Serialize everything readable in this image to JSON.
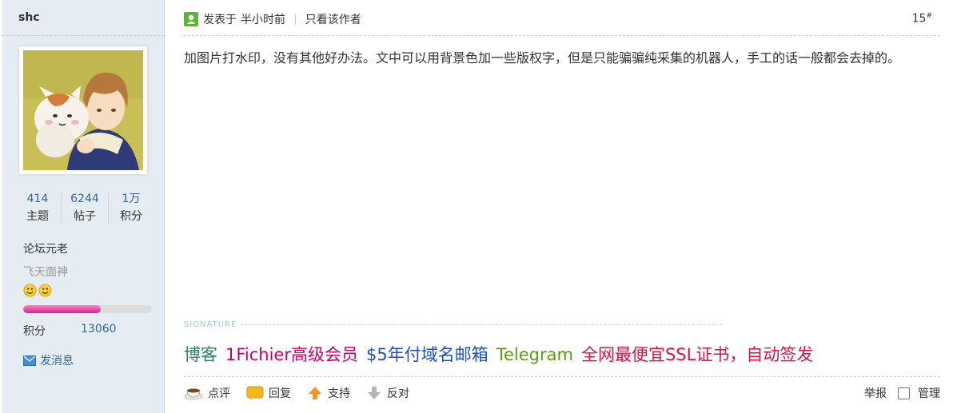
{
  "author": {
    "username": "shc",
    "stats": [
      {
        "value": "414",
        "label": "主题"
      },
      {
        "value": "6244",
        "label": "帖子"
      },
      {
        "value": "1万",
        "label": "积分"
      }
    ],
    "rank": "论坛元老",
    "custom_title": "飞天面神",
    "star_icons": [
      "smiley-face-icon",
      "smiley-face-icon"
    ],
    "progress_fraction": 0.6,
    "score_label": "积分",
    "score_value": "13060",
    "send_message_label": "发消息"
  },
  "post": {
    "posted_label": "发表于",
    "posted_time": "半小时前",
    "separator": "|",
    "only_author_label": "只看该作者",
    "floor_number": "15",
    "floor_mark": "#",
    "content": "加图片打水印，没有其他好办法。文中可以用背景色加一些版权字，但是只能骗骗纯采集的机器人，手工的话一般都会去掉的。"
  },
  "signature": {
    "label": "SIGNATURE",
    "links": [
      {
        "text": "博客",
        "color": "#2e7d6e"
      },
      {
        "text": "1Fichier高级会员",
        "color": "#cc0066"
      },
      {
        "text": "$5年付域名邮箱",
        "color": "#1e4fc2"
      },
      {
        "text": "Telegram",
        "color": "#5a9a1a"
      },
      {
        "text": "全网最便宜SSL证书，自动签发",
        "color": "#dd1144"
      }
    ]
  },
  "actions": {
    "comment": "点评",
    "reply": "回复",
    "support": "支持",
    "oppose": "反对",
    "report": "举报",
    "manage": "管理"
  },
  "colors": {
    "sidebar_bg": "#e5edf2",
    "link_blue": "#336699",
    "progress_pink": "#d2248f"
  }
}
